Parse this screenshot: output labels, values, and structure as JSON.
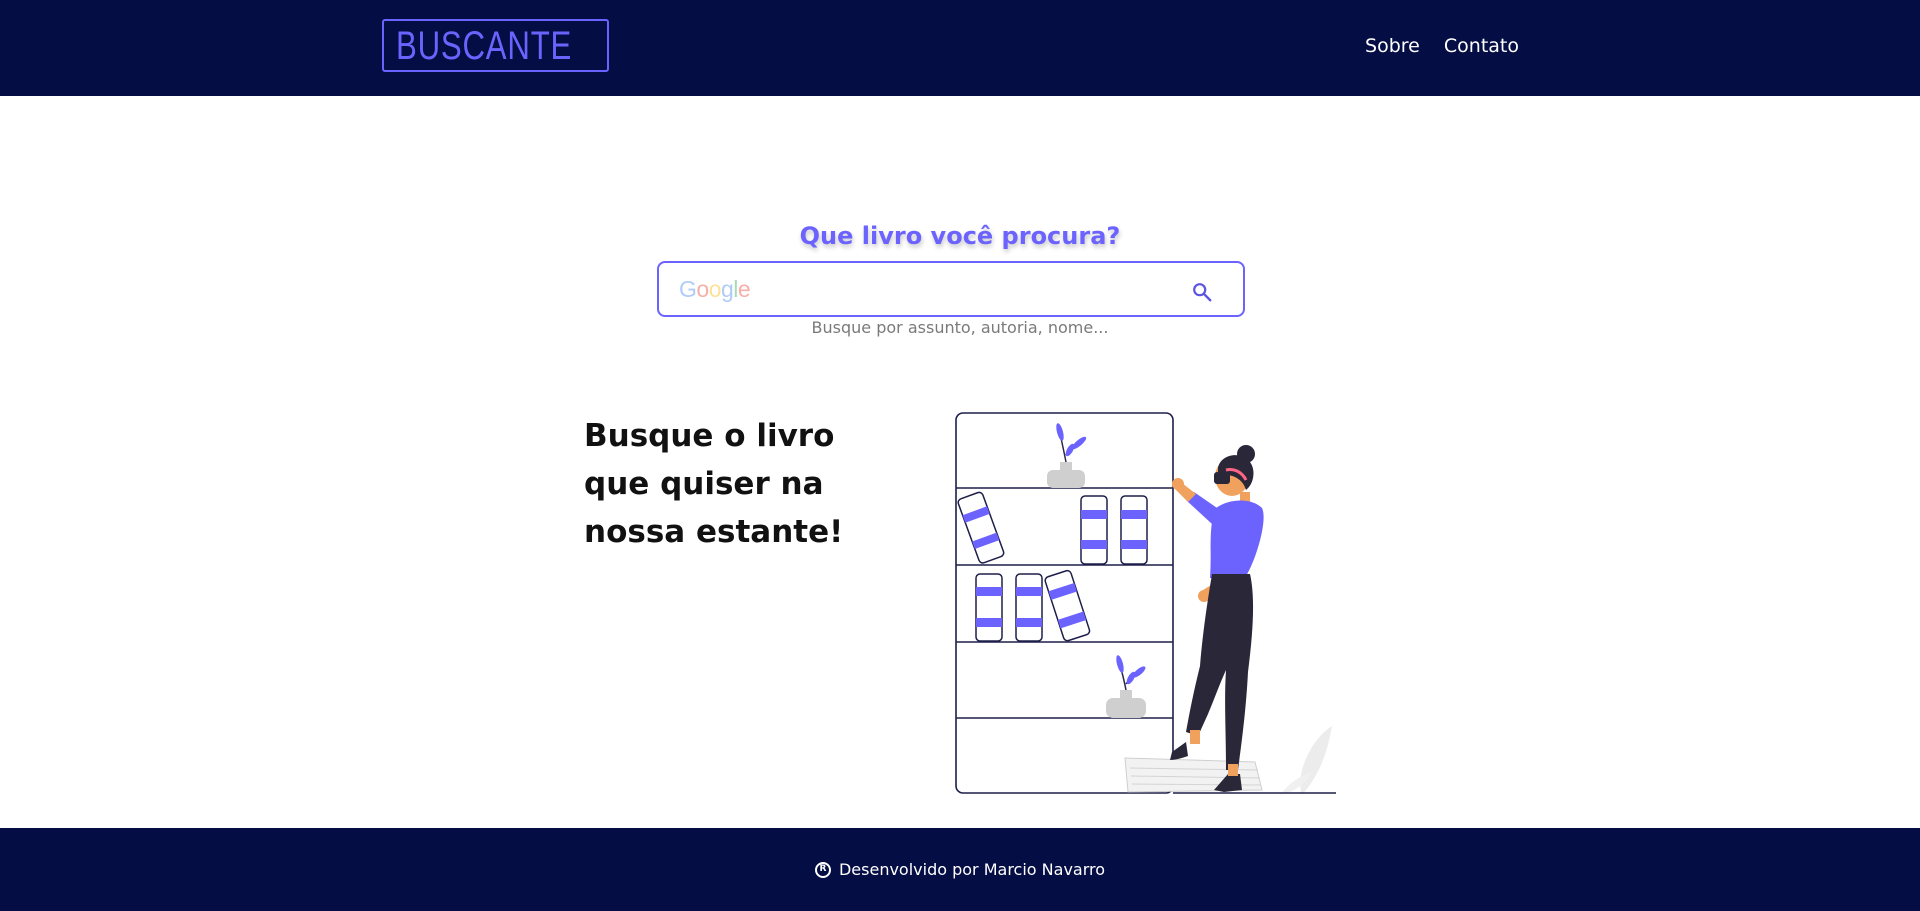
{
  "header": {
    "logo_text": "BUSCANTE",
    "nav": [
      {
        "label": "Sobre"
      },
      {
        "label": "Contato"
      }
    ]
  },
  "search": {
    "title": "Que livro você procura?",
    "input_value": "",
    "google_mark": [
      "G",
      "o",
      "o",
      "g",
      "l",
      "e"
    ],
    "hint": "Busque por assunto, autoria, nome..."
  },
  "hero": {
    "lines": [
      "Busque o livro",
      "que quiser na",
      "nossa estante!"
    ]
  },
  "footer": {
    "reg_symbol": "R",
    "text": "Desenvolvido por Marcio Navarro"
  },
  "colors": {
    "navy": "#050d45",
    "accent": "#6c63ff"
  },
  "icons": {
    "logo": "books-icon",
    "search": "search-icon",
    "footer": "registered-icon"
  }
}
